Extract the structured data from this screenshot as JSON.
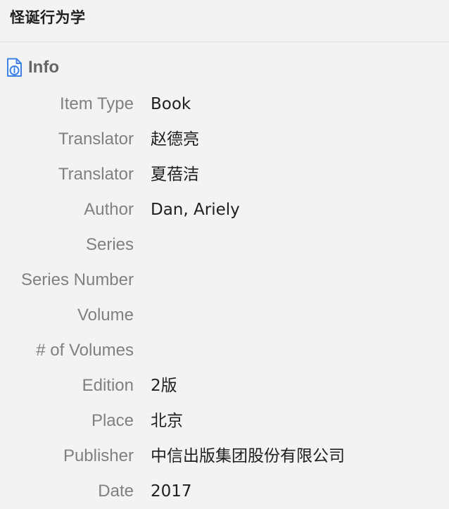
{
  "item": {
    "title": "怪诞行为学"
  },
  "info_section": {
    "label": "Info",
    "icon": "document-info-icon"
  },
  "fields": [
    {
      "label": "Item Type",
      "value": "Book"
    },
    {
      "label": "Translator",
      "value": "赵德亮"
    },
    {
      "label": "Translator",
      "value": "夏蓓洁"
    },
    {
      "label": "Author",
      "value": "Dan, Ariely"
    },
    {
      "label": "Series",
      "value": ""
    },
    {
      "label": "Series Number",
      "value": ""
    },
    {
      "label": "Volume",
      "value": ""
    },
    {
      "label": "# of Volumes",
      "value": ""
    },
    {
      "label": "Edition",
      "value": "2版"
    },
    {
      "label": "Place",
      "value": "北京"
    },
    {
      "label": "Publisher",
      "value": "中信出版集团股份有限公司"
    },
    {
      "label": "Date",
      "value": "2017"
    }
  ],
  "colors": {
    "background": "#f3f3f3",
    "label": "#808080",
    "value": "#1f1f1f",
    "icon": "#3f82e6"
  }
}
